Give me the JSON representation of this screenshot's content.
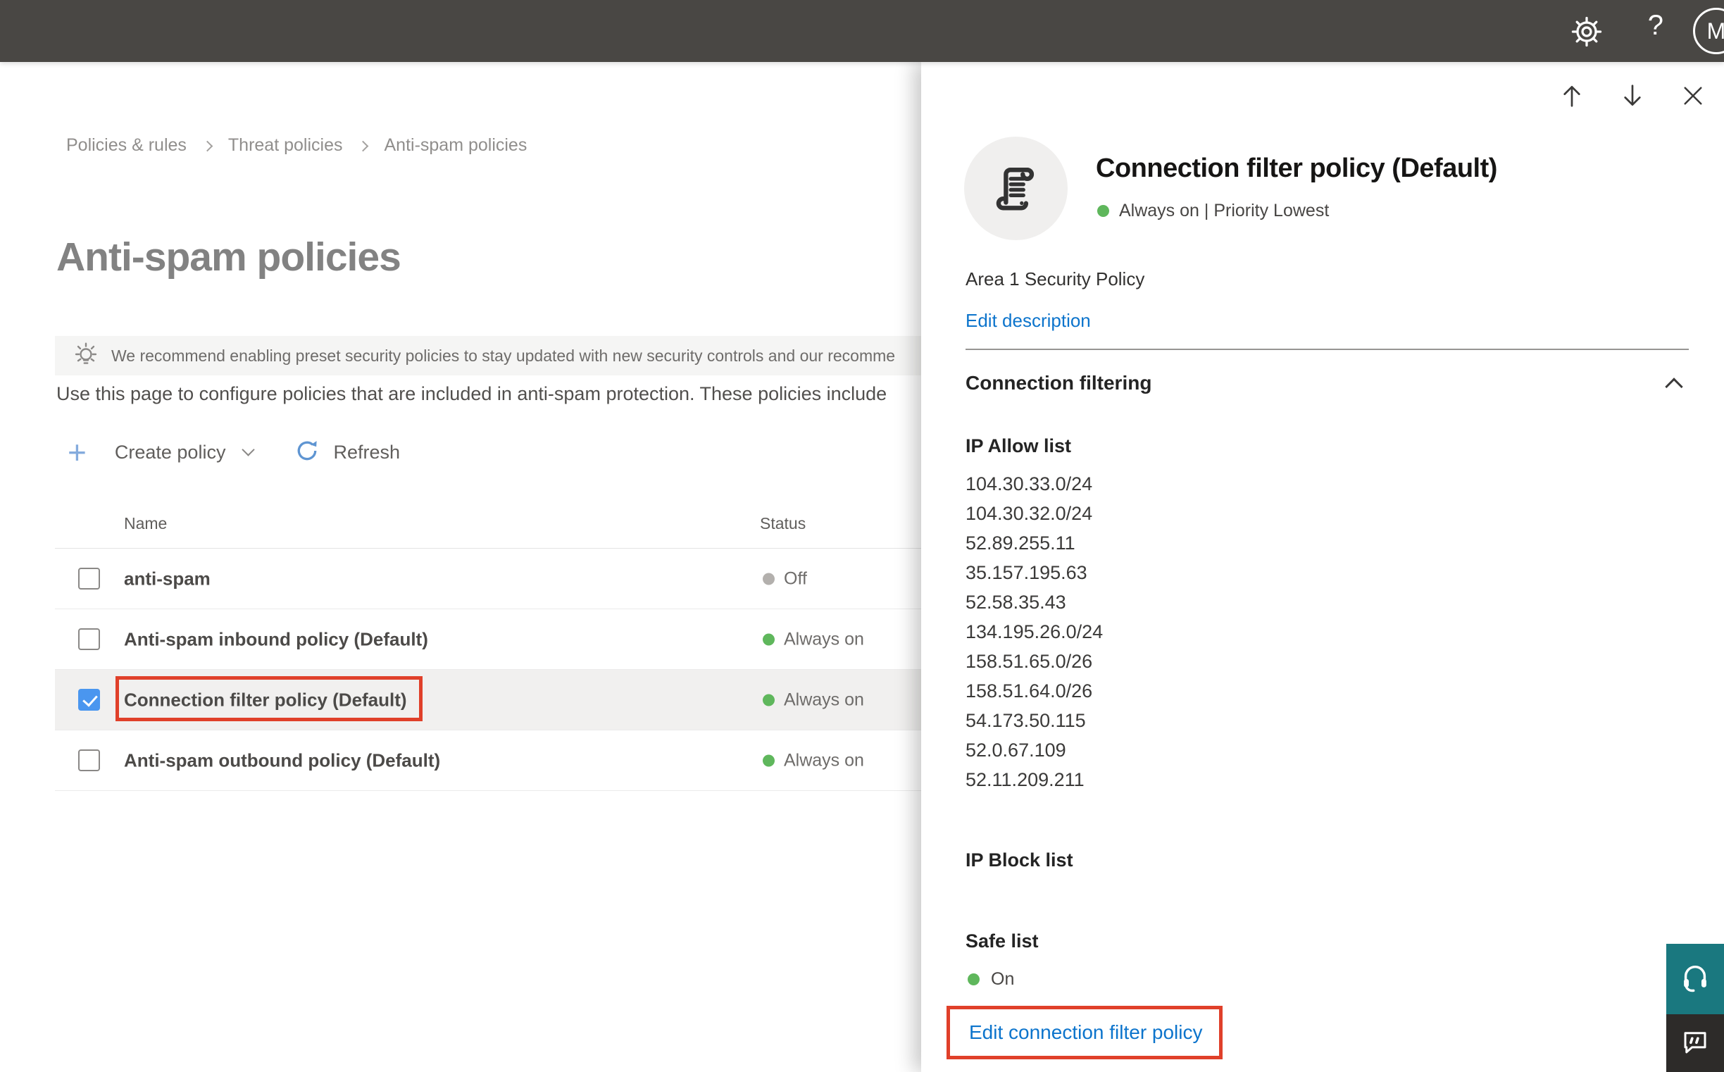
{
  "topbar": {
    "avatar_initial": "M",
    "help_label": "?"
  },
  "breadcrumb": {
    "items": [
      "Policies & rules",
      "Threat policies",
      "Anti-spam policies"
    ]
  },
  "page": {
    "title": "Anti-spam policies",
    "banner_text": "We recommend enabling preset security policies to stay updated with new security controls and our recomme",
    "intro_text": "Use this page to configure policies that are included in anti-spam protection. These policies include",
    "toolbar": {
      "create_label": "Create policy",
      "refresh_label": "Refresh"
    }
  },
  "table": {
    "columns": {
      "name": "Name",
      "status": "Status"
    },
    "rows": [
      {
        "name": "anti-spam",
        "status": "Off",
        "status_color": "off",
        "checked": false,
        "selected": false
      },
      {
        "name": "Anti-spam inbound policy (Default)",
        "status": "Always on",
        "status_color": "on",
        "checked": false,
        "selected": false
      },
      {
        "name": "Connection filter policy (Default)",
        "status": "Always on",
        "status_color": "on",
        "checked": true,
        "selected": true
      },
      {
        "name": "Anti-spam outbound policy (Default)",
        "status": "Always on",
        "status_color": "on",
        "checked": false,
        "selected": false
      }
    ]
  },
  "flyout": {
    "title": "Connection filter policy (Default)",
    "status_text": "Always on | Priority Lowest",
    "description": "Area 1 Security Policy",
    "edit_description_label": "Edit description",
    "section_title": "Connection filtering",
    "ip_allow_title": "IP Allow list",
    "ip_allow_items": [
      "104.30.33.0/24",
      "104.30.32.0/24",
      "52.89.255.11",
      "35.157.195.63",
      "52.58.35.43",
      "134.195.26.0/24",
      "158.51.65.0/26",
      "158.51.64.0/26",
      "54.173.50.115",
      "52.0.67.109",
      "52.11.209.211"
    ],
    "ip_block_title": "IP Block list",
    "safe_list_title": "Safe list",
    "safe_list_status": "On",
    "edit_policy_label": "Edit connection filter policy"
  },
  "colors": {
    "topbar_bg": "#494744",
    "accent_link": "#0c74cc",
    "status_on": "#5fb75c",
    "status_off": "#b3b0ad",
    "selection_red": "#e0402a",
    "checked_checkbox": "#4a96ef",
    "support_teal": "#1a787f",
    "feedback_dark": "#2d2b29"
  }
}
